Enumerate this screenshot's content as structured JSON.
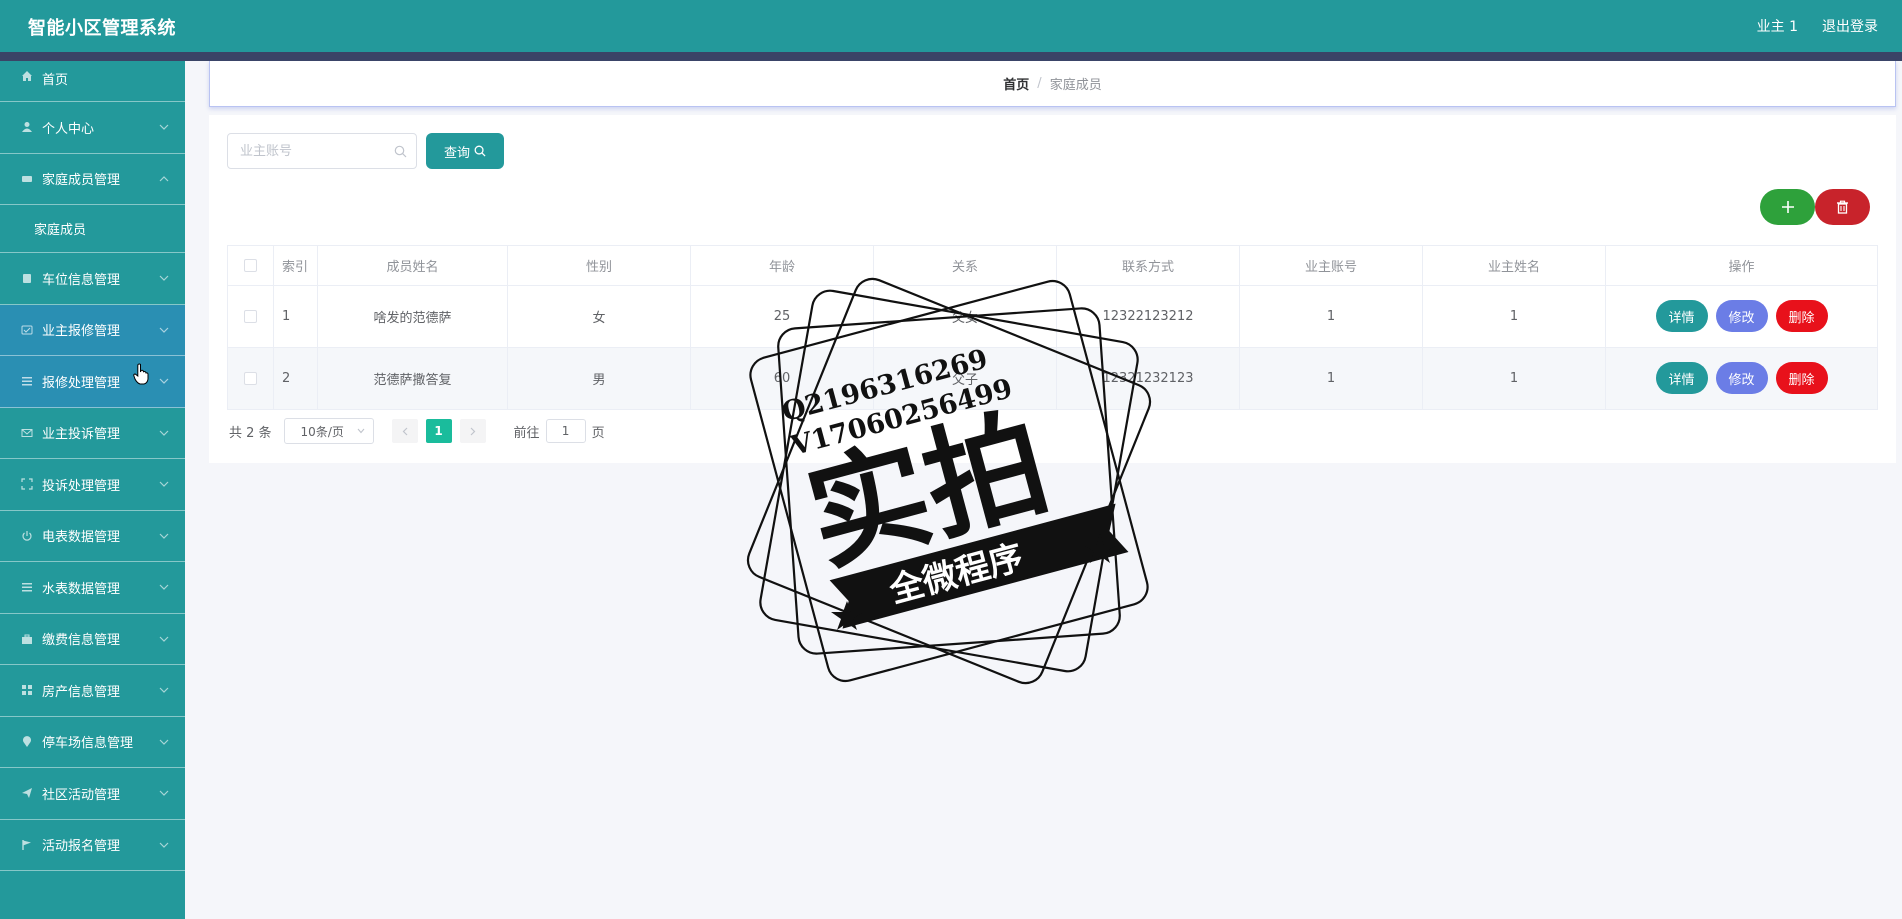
{
  "header": {
    "title": "智能小区管理系统",
    "user": "业主 1",
    "logout": "退出登录"
  },
  "breadcrumb": {
    "home": "首页",
    "separator": "/",
    "current": "家庭成员"
  },
  "sidebar": {
    "items": [
      {
        "label": "首页",
        "icon": "home-icon"
      },
      {
        "label": "个人中心",
        "icon": "person-icon"
      },
      {
        "label": "家庭成员管理",
        "icon": "family-icon"
      },
      {
        "label": "家庭成员",
        "sub": true
      },
      {
        "label": "车位信息管理",
        "icon": "clipboard-icon"
      },
      {
        "label": "业主报修管理",
        "icon": "repair-icon"
      },
      {
        "label": "报修处理管理",
        "icon": "list-icon"
      },
      {
        "label": "业主投诉管理",
        "icon": "mail-icon"
      },
      {
        "label": "投诉处理管理",
        "icon": "frame-icon"
      },
      {
        "label": "电表数据管理",
        "icon": "power-icon"
      },
      {
        "label": "水表数据管理",
        "icon": "list-icon"
      },
      {
        "label": "缴费信息管理",
        "icon": "briefcase-icon"
      },
      {
        "label": "房产信息管理",
        "icon": "grid-icon"
      },
      {
        "label": "停车场信息管理",
        "icon": "location-icon"
      },
      {
        "label": "社区活动管理",
        "icon": "send-icon"
      },
      {
        "label": "活动报名管理",
        "icon": "flag-icon"
      }
    ]
  },
  "search": {
    "placeholder": "业主账号",
    "value": "",
    "button": "查询"
  },
  "table": {
    "headers": [
      "索引",
      "成员姓名",
      "性别",
      "年龄",
      "关系",
      "联系方式",
      "业主账号",
      "业主姓名",
      "操作"
    ],
    "rows": [
      {
        "index": "1",
        "name": "啥发的范德萨",
        "gender": "女",
        "age": "25",
        "relation": "父女",
        "phone": "12322123212",
        "owner_account": "1",
        "owner_name": "1"
      },
      {
        "index": "2",
        "name": "范德萨撒答复",
        "gender": "男",
        "age": "60",
        "relation": "父子",
        "phone": "12321232123",
        "owner_account": "1",
        "owner_name": "1"
      }
    ],
    "actions": {
      "detail": "详情",
      "edit": "修改",
      "delete": "删除"
    }
  },
  "pagination": {
    "total": "共 2 条",
    "page_size": "10条/页",
    "current": "1",
    "goto_prefix": "前往",
    "goto_value": "1",
    "goto_suffix": "页"
  },
  "watermark": {
    "line1": "Q2196316269",
    "line2": "V17060256499",
    "main": "实拍",
    "banner": "全微程序"
  },
  "colors": {
    "primary": "#23999b",
    "stripe": "#3a4466",
    "highlight": "#2a8fb3",
    "add": "#2ea13b",
    "delete": "#e8111b",
    "edit": "#6b7de6",
    "page_active": "#1abc9c"
  }
}
